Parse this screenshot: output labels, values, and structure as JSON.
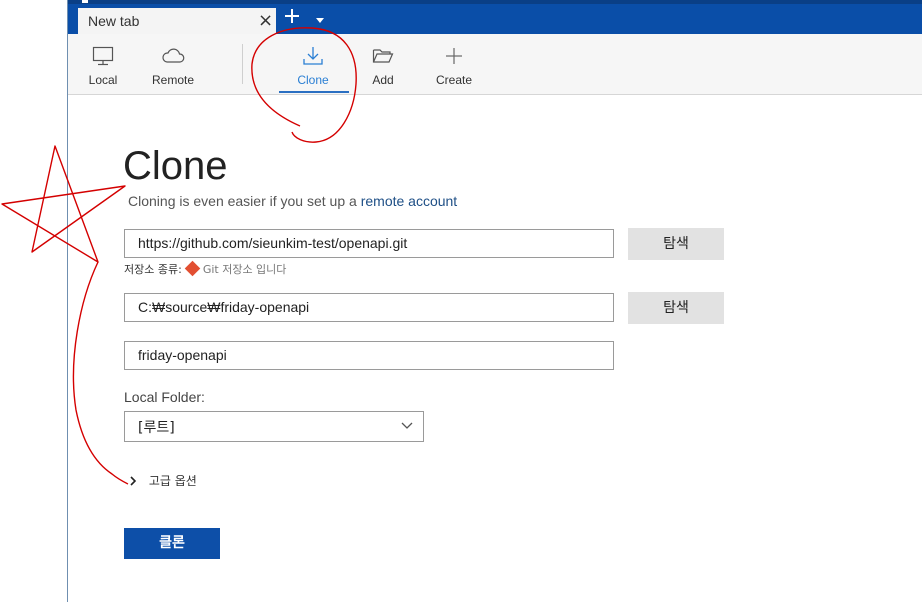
{
  "tabbar": {
    "tab_title": "New tab",
    "close_glyph": "×",
    "accent_color": "#0a4ea8"
  },
  "toolbar": {
    "local_label": "Local",
    "remote_label": "Remote",
    "clone_label": "Clone",
    "add_label": "Add",
    "create_label": "Create",
    "active": "Clone",
    "icons": [
      "monitor-icon",
      "cloud-icon",
      "download-icon",
      "folder-open-icon",
      "plus-icon"
    ]
  },
  "page": {
    "title": "Clone",
    "subtitle_prefix": "Cloning is even easier if you set up a",
    "subtitle_link": "remote account"
  },
  "form": {
    "url_value": "https://github.com/sieunkim-test/openapi.git",
    "browse_label": "탐색",
    "repo_type_label": "저장소 종류:",
    "repo_type_value": "Git 저장소 입니다",
    "path_value": "C:₩source₩friday-openapi",
    "name_value": "friday-openapi",
    "local_folder_label": "Local Folder:",
    "local_folder_value": "[루트]",
    "advanced_label": "고급 옵션",
    "submit_label": "클론"
  },
  "colors": {
    "primary_button": "#0d4fa8",
    "link": "#1e4f86",
    "active_tab_text": "#2a7fd4",
    "annotation": "#d40000"
  }
}
